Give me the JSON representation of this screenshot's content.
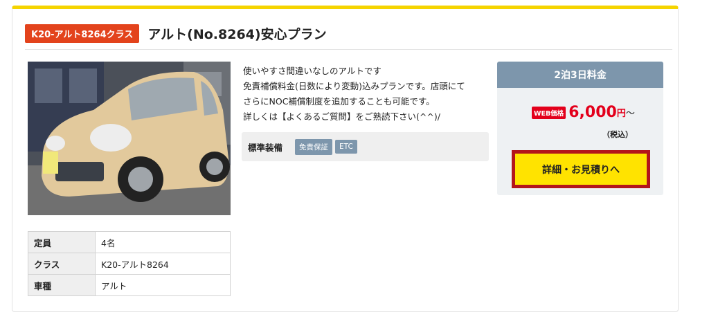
{
  "plan": {
    "class_tag": "K20-アルト8264クラス",
    "title": "アルト(No.8264)安心プラン"
  },
  "description": [
    "使いやすさ間違いなしのアルトです",
    "免責補償料金(日数により変動)込みプランです。店頭にて",
    "さらにNOC補償制度を追加することも可能です。",
    "詳しくは【よくあるご質問】をご熟読下さい(^^)/"
  ],
  "equipment": {
    "label": "標準装備",
    "tags": [
      "免責保証",
      "ETC"
    ]
  },
  "specs": [
    {
      "key": "定員",
      "value": "4名"
    },
    {
      "key": "クラス",
      "value": "K20-アルト8264"
    },
    {
      "key": "車種",
      "value": "アルト"
    }
  ],
  "price": {
    "header": "2泊3日料金",
    "web_badge": "WEB価格",
    "amount": "6,000",
    "unit": "円",
    "suffix": "〜",
    "tax_note": "（税込）",
    "button_label": "詳細・お見積りへ"
  },
  "colors": {
    "accent_yellow": "#f5d400",
    "tag_red": "#e3431c",
    "price_red": "#e3001b",
    "price_header": "#7d96ac",
    "button_yellow": "#ffe300",
    "button_border": "#b3151b"
  }
}
